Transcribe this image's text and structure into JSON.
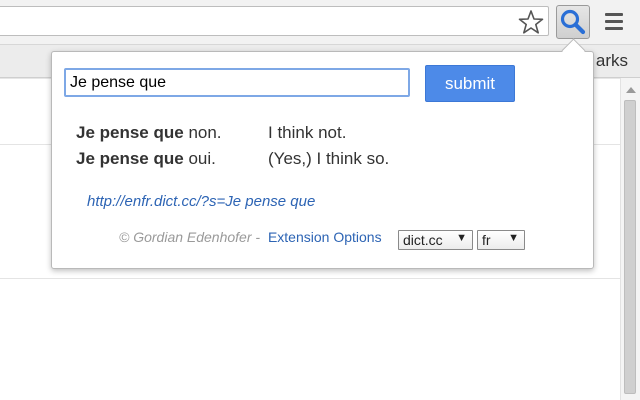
{
  "toolbar": {
    "bookmarks_label": "arks"
  },
  "popup": {
    "query_value": "Je pense que",
    "submit_label": "submit",
    "results": [
      {
        "term": "Je pense que",
        "rest": " non.",
        "translation": "I think not."
      },
      {
        "term": "Je pense que",
        "rest": " oui.",
        "translation": "(Yes,) I think so."
      }
    ],
    "link_text": "http://enfr.dict.cc/?s=Je pense que",
    "footer": {
      "copyright": "© Gordian Edenhofer -",
      "options_label": "Extension Options",
      "dict_select": "dict.cc",
      "lang_select": "fr",
      "select_arrow": "▼"
    }
  },
  "colors": {
    "accent": "#4d8ae8",
    "link": "#2d64b4"
  },
  "icons": [
    "star-icon",
    "search-icon",
    "menu-icon"
  ]
}
